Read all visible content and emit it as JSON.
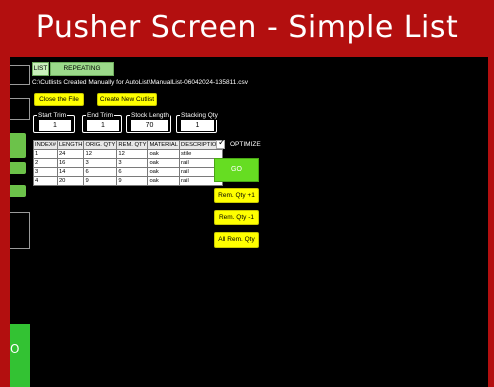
{
  "banner": {
    "title": "Pusher Screen - Simple List"
  },
  "tabs": [
    {
      "label": "LIST"
    },
    {
      "label": "REPEATING PATTERN"
    }
  ],
  "file_path": "C:\\Cutlists Created Manually for AutoList\\ManualList-06042024-135811.csv",
  "buttons": {
    "close_file": "Close the File",
    "create_cutlist": "Create New Cutlist",
    "go": "GO",
    "rem_qty_plus": "Rem. Qty +1",
    "rem_qty_minus": "Rem. Qty -1",
    "all_rem_qty": "All Rem. Qty"
  },
  "fields": {
    "start_trim": {
      "label": "Start Trim",
      "value": "1"
    },
    "end_trim": {
      "label": "End Trim",
      "value": "1"
    },
    "stock_length": {
      "label": "Stock Length",
      "value": "70"
    },
    "stacking_qty": {
      "label": "Stacking Qty",
      "value": "1"
    }
  },
  "table": {
    "headers": [
      "INDEX#",
      "LENGTH",
      "ORIG. QTY",
      "REM. QTY",
      "MATERIAL",
      "DESCRIPTION"
    ],
    "rows": [
      [
        "1",
        "24",
        "12",
        "12",
        "oak",
        "stile"
      ],
      [
        "2",
        "16",
        "3",
        "3",
        "oak",
        "rail"
      ],
      [
        "3",
        "14",
        "6",
        "6",
        "oak",
        "rail"
      ],
      [
        "4",
        "20",
        "9",
        "9",
        "oak",
        "rail"
      ]
    ]
  },
  "optimize": {
    "label": "OPTIMIZE",
    "checked": true
  },
  "left_panel": {
    "big_button_glyph": "O"
  },
  "colors": {
    "banner": "#b30f0f",
    "tab": "#9bd98a",
    "yellow_button": "#ffff00",
    "go_button": "#66dd22"
  }
}
